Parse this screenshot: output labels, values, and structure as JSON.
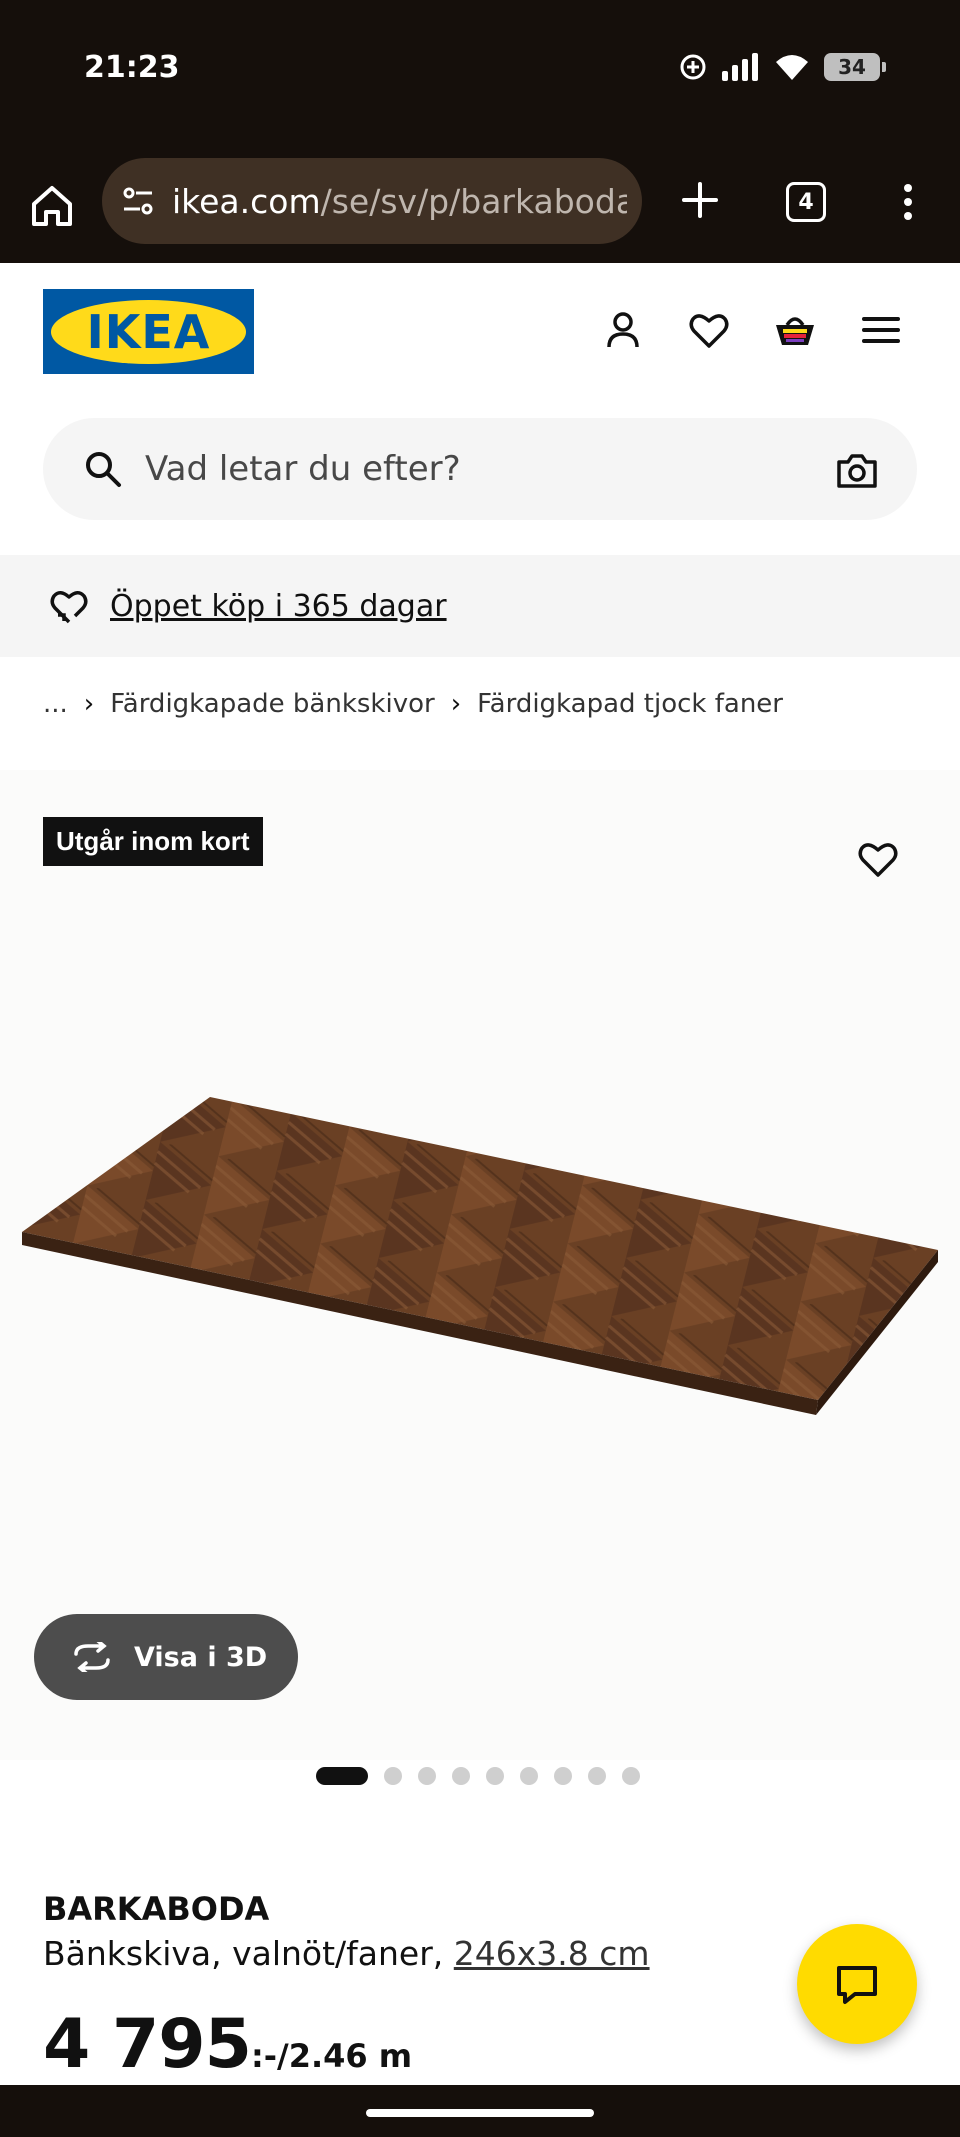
{
  "status_bar": {
    "time": "21:23",
    "battery": "34"
  },
  "browser": {
    "url_domain": "ikea.com",
    "url_path": "/se/sv/p/barkaboda-",
    "tab_count": "4"
  },
  "header": {
    "logo_text": "IKEA"
  },
  "search": {
    "placeholder": "Vad letar du efter?"
  },
  "promo": {
    "text": "Öppet köp i 365 dagar"
  },
  "breadcrumb": {
    "ellipsis": "...",
    "items": [
      "Färdigkapade bänkskivor",
      "Färdigkapad tjock faner"
    ]
  },
  "gallery": {
    "badge": "Utgår inom kort",
    "view_3d_label": "Visa i 3D",
    "image_count": 9,
    "active_index": 0
  },
  "product": {
    "name": "BARKABODA",
    "description": "Bänkskiva, valnöt/faner, ",
    "size": "246x3.8 cm",
    "price": "4 795",
    "price_unit": ":-/2.46 m"
  },
  "colors": {
    "chrome": "#150f0b",
    "ikea_blue": "#0058a3",
    "ikea_yellow": "#ffda1a",
    "chat_yellow": "#ffdb00"
  }
}
